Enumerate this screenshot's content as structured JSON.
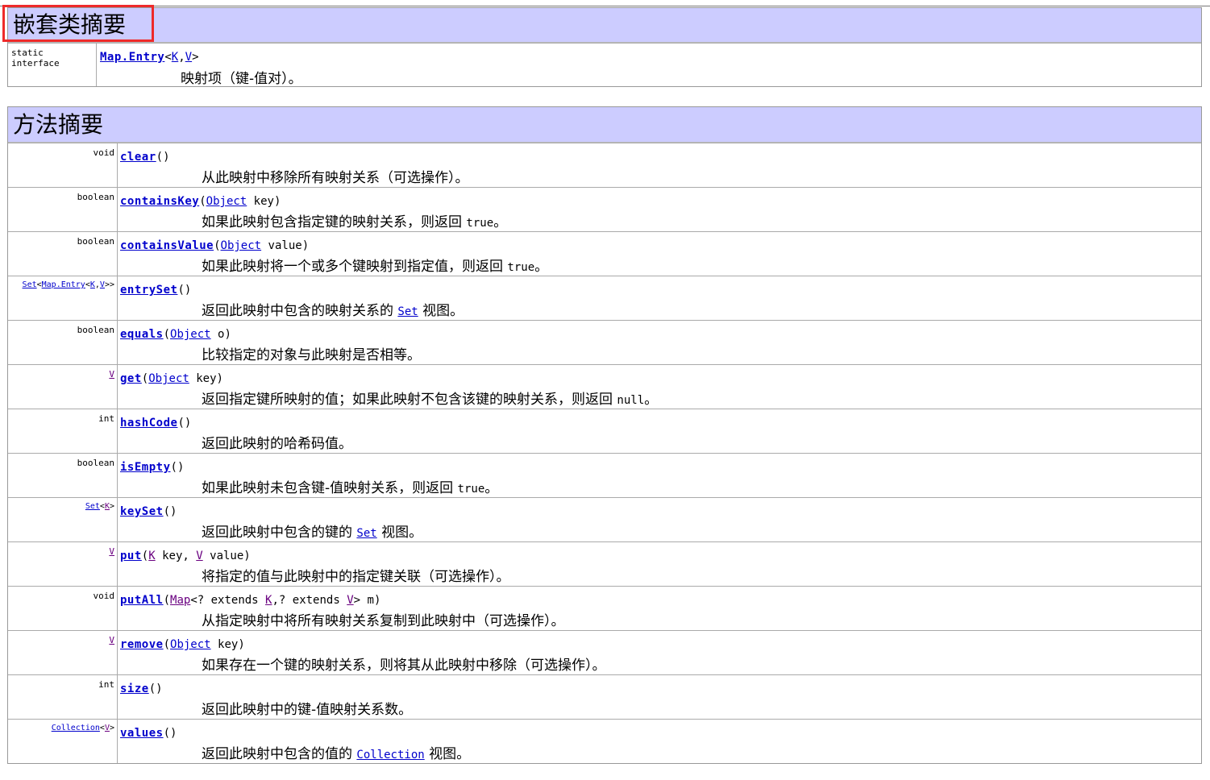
{
  "nested_summary": {
    "title": "嵌套类摘要",
    "rows": [
      {
        "modifier": "static interface",
        "name": "Map.Entry",
        "type_params": [
          "K",
          "V"
        ],
        "description": "映射项（键-值对）。"
      }
    ]
  },
  "method_summary": {
    "title": "方法摘要",
    "rows": [
      {
        "return_type": "void",
        "name": "clear",
        "desc": "从此映射中移除所有映射关系（可选操作）。"
      },
      {
        "return_type": "boolean",
        "name": "containsKey",
        "param_type": "Object",
        "param_name": "key",
        "desc": "如果此映射包含指定键的映射关系，则返回",
        "desc_code": "true",
        "desc_end": "。"
      },
      {
        "return_type": "boolean",
        "name": "containsValue",
        "param_type": "Object",
        "param_name": "value",
        "desc": "如果此映射将一个或多个键映射到指定值，则返回",
        "desc_code": "true",
        "desc_end": "。"
      },
      {
        "return_type_link": "Set",
        "return_type_inner": "Map.Entry",
        "return_type_k": "K",
        "return_type_v": "V",
        "name": "entrySet",
        "desc": "返回此映射中包含的映射关系的",
        "desc_link": "Set",
        "desc_end": "视图。"
      },
      {
        "return_type": "boolean",
        "name": "equals",
        "param_type": "Object",
        "param_name": "o",
        "desc": "比较指定的对象与此映射是否相等。"
      },
      {
        "return_type_link": "V",
        "name": "get",
        "param_type": "Object",
        "param_name": "key",
        "desc": "返回指定键所映射的值；如果此映射不包含该键的映射关系，则返回",
        "desc_code": "null",
        "desc_end": "。"
      },
      {
        "return_type": "int",
        "name": "hashCode",
        "desc": "返回此映射的哈希码值。"
      },
      {
        "return_type": "boolean",
        "name": "isEmpty",
        "desc": "如果此映射未包含键-值映射关系，则返回",
        "desc_code": "true",
        "desc_end": "。"
      },
      {
        "return_type_link": "Set",
        "return_type_k": "K",
        "name": "keySet",
        "desc": "返回此映射中包含的键的",
        "desc_link": "Set",
        "desc_end": "视图。"
      },
      {
        "return_type_link": "V",
        "name": "put",
        "param_k": "K",
        "param_k_name": "key,",
        "param_v": "V",
        "param_v_name": "value",
        "desc": "将指定的值与此映射中的指定键关联（可选操作）。"
      },
      {
        "return_type": "void",
        "name": "putAll",
        "param_map": "Map",
        "param_ext1": "<? extends",
        "param_k": "K",
        "param_ext2": ",? extends",
        "param_v": "V",
        "param_m": "m",
        "desc": "从指定映射中将所有映射关系复制到此映射中（可选操作）。"
      },
      {
        "return_type_link": "V",
        "name": "remove",
        "param_type": "Object",
        "param_name": "key",
        "desc": "如果存在一个键的映射关系，则将其从此映射中移除（可选操作）。"
      },
      {
        "return_type": "int",
        "name": "size",
        "desc": "返回此映射中的键-值映射关系数。"
      },
      {
        "return_type_link": "Collection",
        "return_type_v": "V",
        "name": "values",
        "desc": "返回此映射中包含的值的",
        "desc_link": "Collection",
        "desc_end": "视图。"
      }
    ]
  },
  "colors": {
    "header_bg": "#ccccff",
    "link": "#0000cc",
    "visited_link": "#6a0080",
    "highlight": "#ee2a2a"
  }
}
